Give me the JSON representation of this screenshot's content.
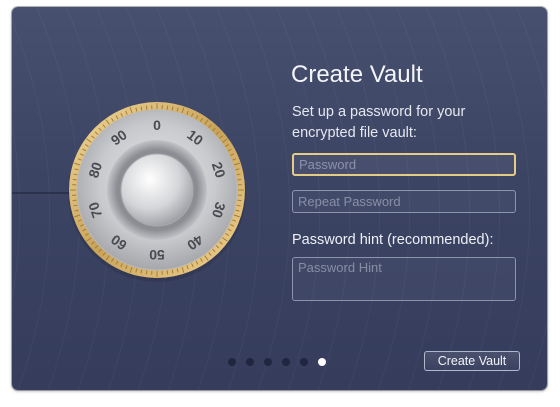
{
  "dialog": {
    "title": "Create Vault",
    "subtitle": "Set up a password for your encrypted file vault:"
  },
  "fields": {
    "password_placeholder": "Password",
    "password_value": "",
    "repeat_placeholder": "Repeat Password",
    "repeat_value": "",
    "hint_label": "Password hint (recommended):",
    "hint_placeholder": "Password Hint",
    "hint_value": ""
  },
  "dial": {
    "numbers": [
      "0",
      "10",
      "20",
      "30",
      "40",
      "50",
      "60",
      "70",
      "80",
      "90"
    ]
  },
  "pager": {
    "total": 6,
    "active_index": 5
  },
  "buttons": {
    "create_label": "Create Vault"
  },
  "colors": {
    "background": "#3c4464",
    "focus_ring": "#e4cb86",
    "dial_gold": "#d9b56e",
    "active_dot": "#ffffff",
    "inactive_dot": "#20263f"
  }
}
